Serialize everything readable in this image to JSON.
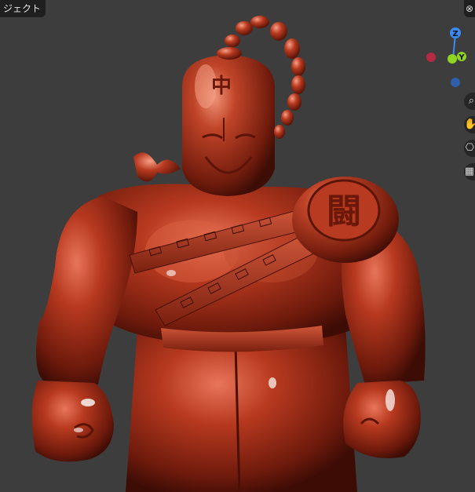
{
  "viewport": {
    "header_tab_label": "ジェクト",
    "corner_icon": "view-toggle-icon"
  },
  "gizmo": {
    "z_label": "Z",
    "y_label": "Y",
    "x_color": "#d3384e",
    "y_color": "#8fd422",
    "z_color": "#3a8af5"
  },
  "toolbar": {
    "icons": [
      "zoom-icon",
      "pan-hand-icon",
      "camera-icon",
      "grid-icon"
    ]
  },
  "model": {
    "head_glyph": "中",
    "shoulder_glyph": "闘",
    "material_color": "#a8341c"
  }
}
